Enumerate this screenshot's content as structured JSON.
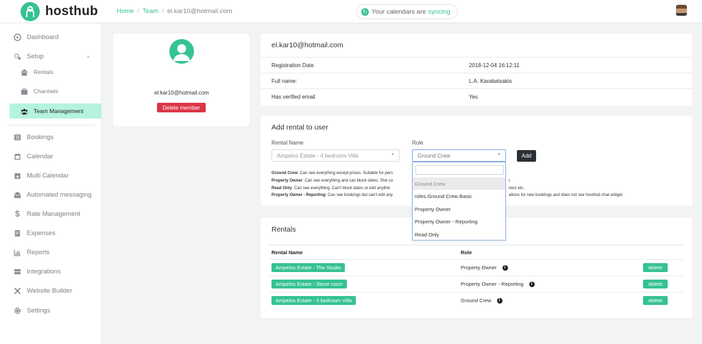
{
  "brand": {
    "name": "hosthub",
    "accent": "#36c293"
  },
  "breadcrumb": {
    "home": "Home",
    "sep": "/",
    "team": "Team",
    "current": "el.kar10@hotmail.com"
  },
  "sync": {
    "prefix": "Your calendars are",
    "status": "syncing"
  },
  "sidebar": {
    "dashboard": "Dashboard",
    "setup": "Setup",
    "rentals": "Rentals",
    "channels": "Channels",
    "team_management": "Team Management",
    "bookings": "Bookings",
    "calendar": "Calendar",
    "multi_calendar": "Multi Calendar",
    "automated_messaging": "Automated messaging",
    "rate_management": "Rate Management",
    "expenses": "Expenses",
    "reports": "Reports",
    "integrations": "Integrations",
    "website_builder": "Website Builder",
    "settings": "Settings"
  },
  "profile": {
    "email": "el.kar10@hotmail.com",
    "delete_label": "Delete member"
  },
  "user_info": {
    "title": "el.kar10@hotmail.com",
    "rows": [
      {
        "label": "Registration Date",
        "value": "2018-12-04 16:12:11"
      },
      {
        "label": "Full name:",
        "value": "L.A. Karabatsakis"
      },
      {
        "label": "Has verified email",
        "value": "Yes"
      }
    ]
  },
  "add_rental": {
    "title": "Add rental to user",
    "rental_name_label": "Rental Name",
    "role_label": "Role",
    "rental_selected": "Ampelos Estate - 4 bedroom Villa",
    "role_selected": "Ground Crew",
    "add_label": "Add",
    "descriptions": [
      {
        "name": "Ground Crew",
        "text": ": Can see everything except prices. Suitable for pers"
      },
      {
        "name": "Property Owner",
        "text": ": Can see everything and can block dates. She co",
        "tail": "r."
      },
      {
        "name": "Read Only",
        "text": ": Can see everything. Can't block dates or edit anythin",
        "tail": "ners etc."
      },
      {
        "name": "Property Owner - Reporting",
        "text": ": Can see bookings but can't edit any",
        "tail": "ations for new bookings and does not see hosthub chat widget."
      }
    ],
    "role_options": [
      "Ground Crew",
      "roles.Ground Crew Basic",
      "Property Owner",
      "Property Owner - Reporting",
      "Read Only"
    ]
  },
  "rentals": {
    "title": "Rentals",
    "col_name": "Rental Name",
    "col_role": "Role",
    "rows": [
      {
        "name": "Ampelos Estate - The Studio",
        "role": "Property Owner",
        "delete": "delete"
      },
      {
        "name": "Ampelos Estate - Stone room",
        "role": "Property Owner - Reporting",
        "delete": "delete"
      },
      {
        "name": "Ampelos Estate - 3 bedroom Villa",
        "role": "Ground Crew",
        "delete": "delete"
      }
    ]
  }
}
